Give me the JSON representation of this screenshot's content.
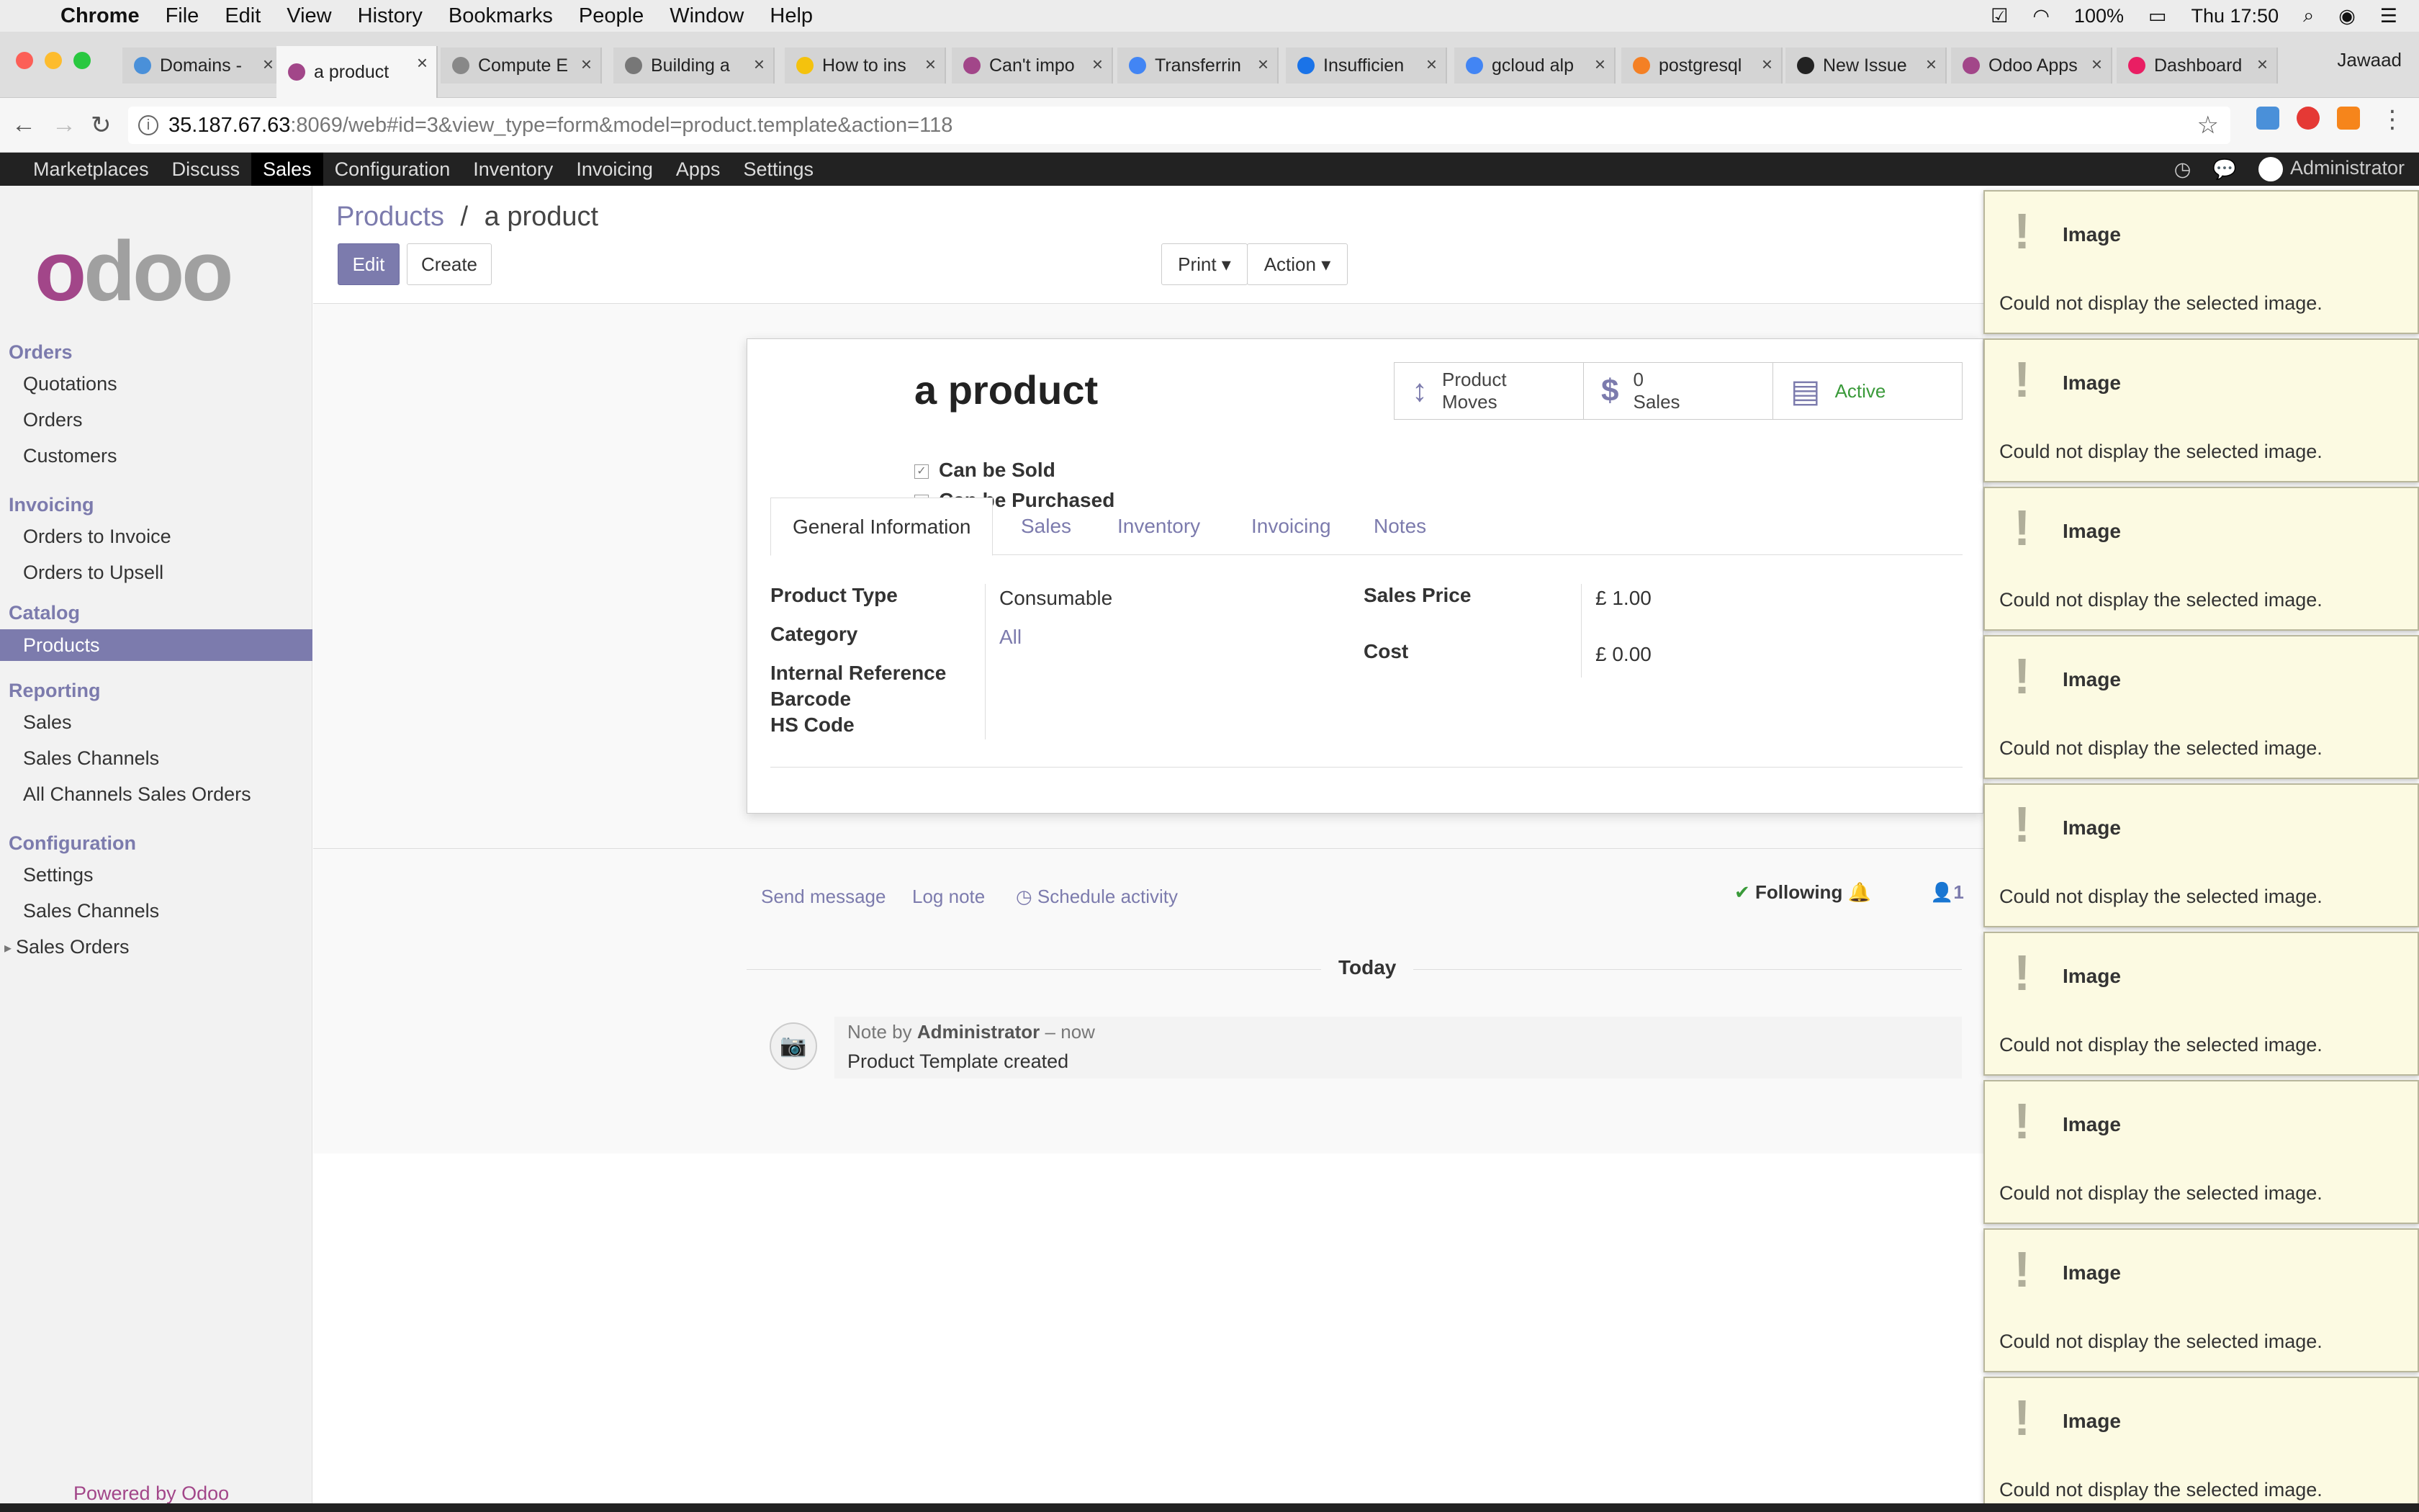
{
  "os_menubar": {
    "app": "Chrome",
    "menus": [
      "File",
      "Edit",
      "View",
      "History",
      "Bookmarks",
      "People",
      "Window",
      "Help"
    ],
    "battery": "100%",
    "clock": "Thu 17:50"
  },
  "browser": {
    "tabs": [
      {
        "title": "Domains -",
        "color": "#4a90d9"
      },
      {
        "title": "a product",
        "color": "#a24689"
      },
      {
        "title": "Compute E",
        "color": "#888888"
      },
      {
        "title": "Building a",
        "color": "#777777"
      },
      {
        "title": "How to ins",
        "color": "#f4c20d"
      },
      {
        "title": "Can't impo",
        "color": "#a24689"
      },
      {
        "title": "Transferrin",
        "color": "#4285f4"
      },
      {
        "title": "Insufficien",
        "color": "#1a73e8"
      },
      {
        "title": "gcloud alp",
        "color": "#4285f4"
      },
      {
        "title": "postgresql",
        "color": "#f48024"
      },
      {
        "title": "New Issue",
        "color": "#222222"
      },
      {
        "title": "Odoo Apps",
        "color": "#a24689"
      },
      {
        "title": "Dashboard",
        "color": "#e91e63"
      }
    ],
    "profile": "Jawaad",
    "url_host": "35.187.67.63",
    "url_rest": ":8069/web#id=3&view_type=form&model=product.template&action=118"
  },
  "topnav": {
    "items": [
      "Marketplaces",
      "Discuss",
      "Sales",
      "Configuration",
      "Inventory",
      "Invoicing",
      "Apps",
      "Settings"
    ],
    "active_index": 2,
    "user": "Administrator"
  },
  "sidebar": {
    "logo": "odoo",
    "sections": [
      {
        "title": "Orders",
        "items": [
          "Quotations",
          "Orders",
          "Customers"
        ]
      },
      {
        "title": "Invoicing",
        "items": [
          "Orders to Invoice",
          "Orders to Upsell"
        ]
      },
      {
        "title": "Catalog",
        "items": [
          "Products"
        ]
      },
      {
        "title": "Reporting",
        "items": [
          "Sales",
          "Sales Channels",
          "All Channels Sales Orders"
        ]
      },
      {
        "title": "Configuration",
        "items": [
          "Settings",
          "Sales Channels",
          "Sales Orders"
        ]
      }
    ],
    "active_item": "Products",
    "powered_by": "Powered by",
    "powered_brand": "Odoo"
  },
  "control": {
    "breadcrumb_parent": "Products",
    "breadcrumb_sep": "/",
    "breadcrumb_current": "a product",
    "edit": "Edit",
    "create": "Create",
    "print": "Print ▾",
    "action": "Action ▾"
  },
  "form": {
    "name": "a product",
    "can_be_sold": "Can be Sold",
    "can_be_purchased": "Can be Purchased",
    "smart_buttons": [
      {
        "icon": "↕",
        "line1": "Product",
        "line2": "Moves"
      },
      {
        "icon": "$",
        "line1": "0",
        "line2": "Sales"
      },
      {
        "icon": "▤",
        "line1": "Active",
        "line2": ""
      }
    ],
    "tabs": [
      "General Information",
      "Sales",
      "Inventory",
      "Invoicing",
      "Notes"
    ],
    "active_tab": 0,
    "fields": {
      "product_type_label": "Product Type",
      "product_type_value": "Consumable",
      "category_label": "Category",
      "category_value": "All",
      "internal_ref_label": "Internal Reference",
      "barcode_label": "Barcode",
      "hs_code_label": "HS Code",
      "sales_price_label": "Sales Price",
      "sales_price_value": "£ 1.00",
      "cost_label": "Cost",
      "cost_value": "£ 0.00"
    }
  },
  "chatter": {
    "send_message": "Send message",
    "log_note": "Log note",
    "schedule_activity": "Schedule activity",
    "following": "Following",
    "followers": "1",
    "date_divider": "Today",
    "message_prefix": "Note by",
    "message_author": "Administrator",
    "message_time": "– now",
    "message_body": "Product Template created"
  },
  "notifications": {
    "title": "Image",
    "message": "Could not display the selected image.",
    "count": 9
  },
  "colors": {
    "odoo_purple": "#7c7bad",
    "odoo_brand": "#a24689",
    "notification_bg": "#fcfae2"
  }
}
